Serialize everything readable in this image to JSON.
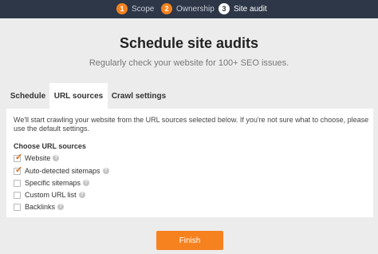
{
  "steps": [
    {
      "num": "1",
      "label": "Scope"
    },
    {
      "num": "2",
      "label": "Ownership"
    },
    {
      "num": "3",
      "label": "Site audit"
    }
  ],
  "page": {
    "title": "Schedule site audits",
    "subtitle": "Regularly check your website for 100+ SEO issues."
  },
  "tabs": [
    {
      "label": "Schedule"
    },
    {
      "label": "URL sources",
      "active": true
    },
    {
      "label": "Crawl settings"
    }
  ],
  "panel": {
    "intro": "We'll start crawling your website from the URL sources selected below. If you're not sure what to choose, please use the default settings.",
    "choose_label": "Choose URL sources",
    "options": [
      {
        "label": "Website",
        "checked": true
      },
      {
        "label": "Auto-detected sitemaps",
        "checked": true
      },
      {
        "label": "Specific sitemaps",
        "checked": false
      },
      {
        "label": "Custom URL list",
        "checked": false
      },
      {
        "label": "Backlinks",
        "checked": false
      }
    ],
    "help_glyph": "?",
    "check_glyph": "✓"
  },
  "finish_label": "Finish",
  "colors": {
    "accent": "#f5821f",
    "topbar": "#2d3748"
  }
}
